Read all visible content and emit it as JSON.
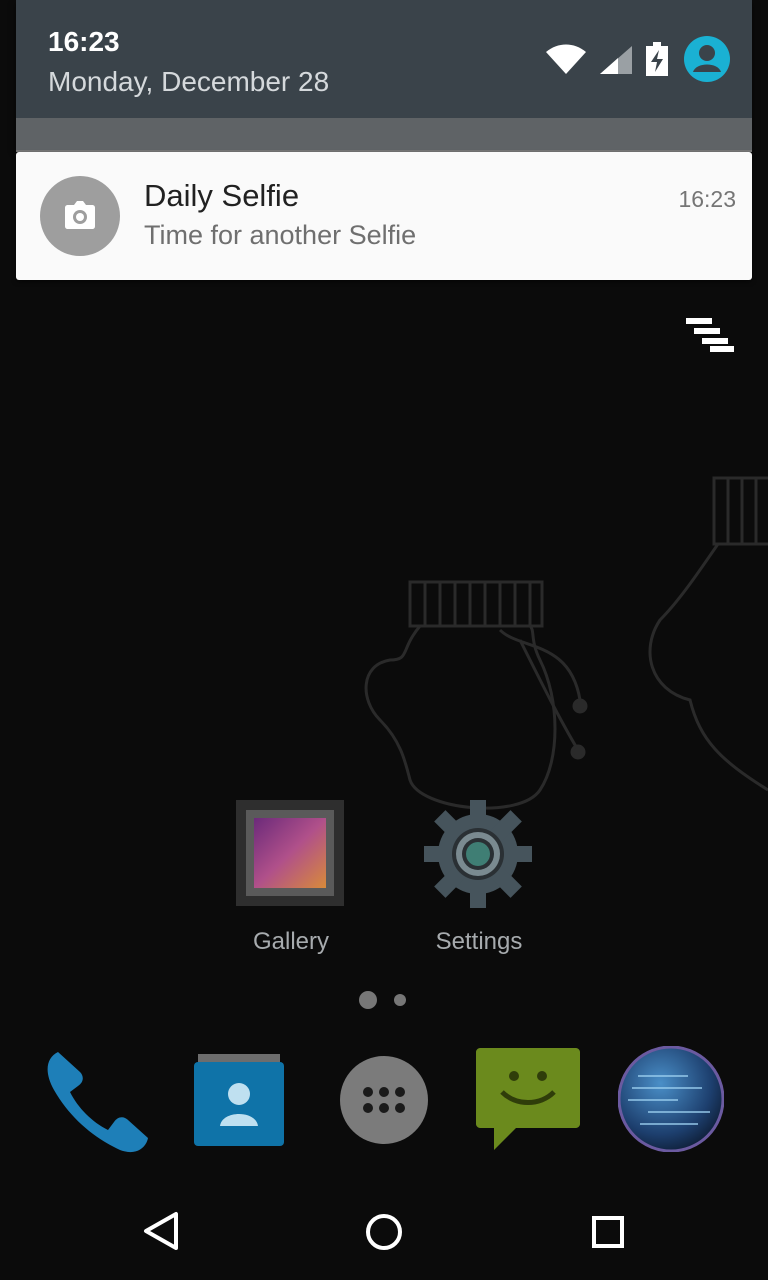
{
  "status_bar": {
    "time": "16:23",
    "date": "Monday, December 28",
    "icons": [
      "wifi-icon",
      "cell-signal-icon",
      "battery-charging-icon",
      "user-avatar-icon"
    ]
  },
  "notification": {
    "app_icon": "camera-icon",
    "title": "Daily Selfie",
    "text": "Time for another Selfie",
    "time": "16:23"
  },
  "home": {
    "apps": [
      {
        "label": "Gallery",
        "icon": "gallery-icon"
      },
      {
        "label": "Settings",
        "icon": "settings-gear-icon"
      }
    ],
    "page_count": 2,
    "current_page": 1,
    "dock": [
      "phone-icon",
      "contacts-icon",
      "app-drawer-icon",
      "messaging-icon",
      "browser-globe-icon"
    ]
  },
  "navigation": [
    "back-icon",
    "home-icon",
    "recents-icon"
  ],
  "colors": {
    "shade_bg": "#3a434a",
    "accent_avatar": "#1ab1d3",
    "phone_blue": "#1e7fb8",
    "messaging_green": "#6b8a1d"
  }
}
